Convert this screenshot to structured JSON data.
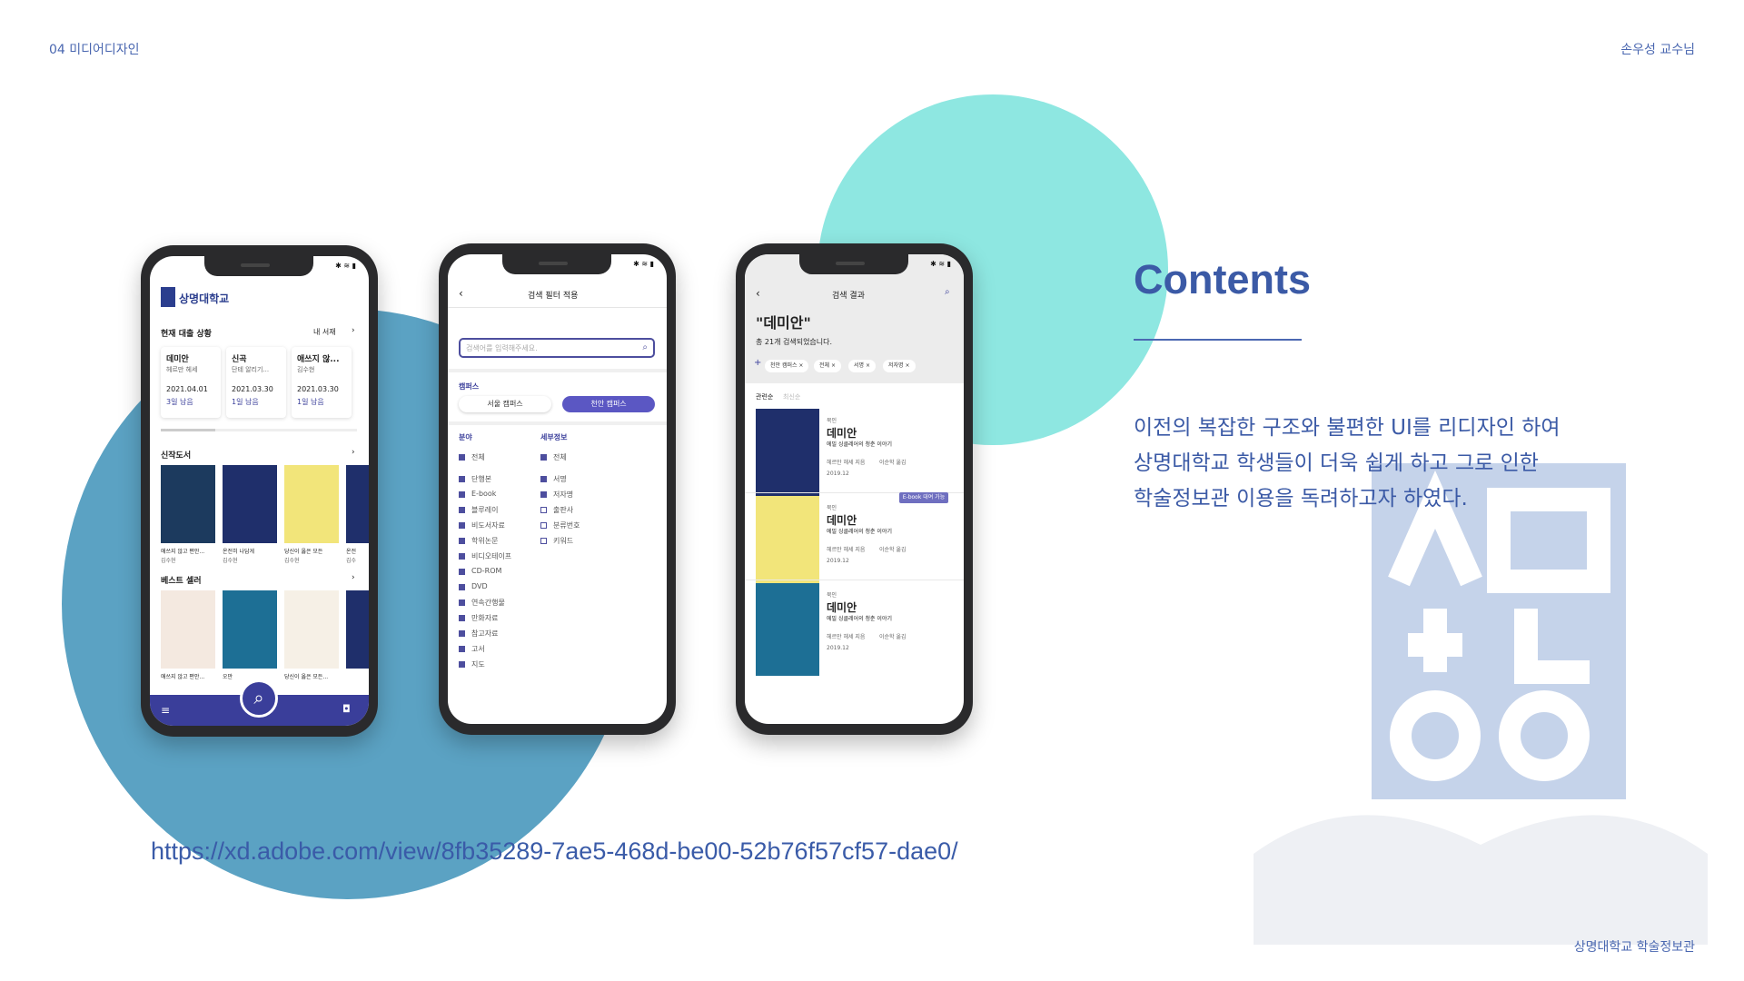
{
  "header": {
    "left": "04 미디어디자인",
    "right": "손우성 교수님"
  },
  "footer": {
    "right": "상명대학교 학술정보관"
  },
  "contents": {
    "title": "Contents",
    "lines": [
      "이전의 복잡한 구조와 불편한 UI를 리디자인 하여",
      "상명대학교 학생들이 더욱 쉽게 하고 그로 인한",
      "학술정보관 이용을 독려하고자 하였다."
    ]
  },
  "url": "https://xd.adobe.com/view/8fb35289-7ae5-468d-be00-52b76f57cf57-dae0/",
  "colors": {
    "accent": "#3b5aa6",
    "circle_blue": "#5ba2c3",
    "circle_teal": "#8ee7e1",
    "nav": "#3a3e9a"
  },
  "phone1": {
    "logo_text": "상명대학교",
    "loan_title": "현재 대출 상황",
    "my_shelf": "내 서재",
    "loans": [
      {
        "title": "데미안",
        "author": "헤르만 헤세",
        "date": "2021.04.01",
        "remain": "3일 남음"
      },
      {
        "title": "신곡",
        "author": "단테 알리기...",
        "date": "2021.03.30",
        "remain": "1일 남음"
      },
      {
        "title": "애쓰지 않...",
        "author": "김수현",
        "date": "2021.03.30",
        "remain": "1일 남음"
      }
    ],
    "new_books_title": "신작도서",
    "new_books": [
      {
        "title": "애쓰지 않고 편안...",
        "author": "김수현"
      },
      {
        "title": "온전히 나답게",
        "author": "김수현"
      },
      {
        "title": "당신이 옳은 모든",
        "author": "김수현"
      },
      {
        "title": "온전",
        "author": "김수"
      }
    ],
    "best_title": "베스트 셀러",
    "best_books": [
      "애쓰지 않고 편안...",
      "오만",
      "당신이 옳은 모든..."
    ],
    "icons": {
      "menu": "menu-icon",
      "search": "search-icon",
      "user": "user-icon"
    }
  },
  "phone2": {
    "title": "검색 필터 적용",
    "placeholder": "검색어를 입력해주세요.",
    "campus_label": "캠퍼스",
    "campus_seoul": "서울 캠퍼스",
    "campus_cheonan": "천안 캠퍼스",
    "category_label": "분야",
    "detail_label": "세부정보",
    "categories": [
      "전체",
      "단행본",
      "E-book",
      "블루레이",
      "비도서자료",
      "학위논문",
      "비디오테이프",
      "CD-ROM",
      "DVD",
      "연속간행물",
      "만화자료",
      "참고자료",
      "고서",
      "지도"
    ],
    "details": [
      "전체",
      "서명",
      "저자명",
      "출판사",
      "분류번호",
      "키워드"
    ]
  },
  "phone3": {
    "title": "검색 결과",
    "query": "\"데미안\"",
    "count": "총 21개 검색되었습니다.",
    "chips": [
      "천안 캠퍼스",
      "전체",
      "서명",
      "저자명"
    ],
    "sort_label": "관련순",
    "sort_alt": "최신순",
    "results": [
      {
        "tag": "북인",
        "title": "데미안",
        "subtitle": "에밀 싱클레어의 청춘 이야기",
        "author": "헤르만 헤세 지음",
        "translator": "이순학 옮김",
        "year": "2019.12",
        "badge": "E-book 대여 가능"
      },
      {
        "tag": "북인",
        "title": "데미안",
        "subtitle": "에밀 싱클레어의 청춘 이야기",
        "author": "헤르만 헤세 지음",
        "translator": "이순학 옮김",
        "year": "2019.12"
      },
      {
        "tag": "북인",
        "title": "데미안",
        "subtitle": "에밀 싱클레어의 청춘 이야기",
        "author": "헤르만 헤세 지음",
        "translator": "이순학 옮김",
        "year": "2019.12"
      }
    ]
  }
}
